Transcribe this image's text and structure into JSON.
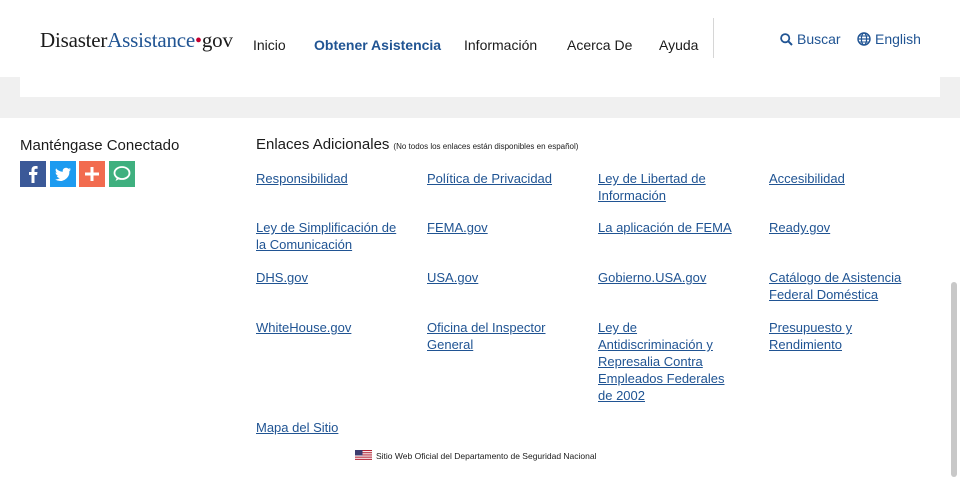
{
  "header": {
    "logo": {
      "part1": "Disaster",
      "part2": "Assistance",
      "dot": "•",
      "part3": "gov"
    },
    "nav": [
      {
        "label": "Inicio",
        "active": false
      },
      {
        "label": "Obtener Asistencia",
        "active": true
      },
      {
        "label": "Información",
        "active": false
      },
      {
        "label": "Acerca De",
        "active": false
      },
      {
        "label": "Ayuda",
        "active": false
      }
    ],
    "search_label": "Buscar",
    "language_label": "English"
  },
  "footer": {
    "connect_title": "Manténgase Conectado",
    "social": [
      {
        "icon": "facebook-icon",
        "color": "#3b5998"
      },
      {
        "icon": "twitter-icon",
        "color": "#1d9bf0"
      },
      {
        "icon": "plus-share-icon",
        "color": "#f26b4f"
      },
      {
        "icon": "chat-bubble-icon",
        "color": "#3fb07f"
      }
    ],
    "links_title": "Enlaces Adicionales",
    "links_note": "(No todos los enlaces están disponibles en español)",
    "links": [
      "Responsibilidad",
      "Política de Privacidad",
      "Ley de Libertad de Información",
      "Accesibilidad",
      "Ley de Simplificación de la Comunicación",
      "FEMA.gov",
      "La aplicación de FEMA",
      "Ready.gov",
      "DHS.gov",
      "USA.gov",
      "Gobierno.USA.gov",
      "Catálogo de Asistencia Federal Doméstica",
      "WhiteHouse.gov",
      "Oficina del Inspector General",
      "Ley de Antidiscriminación y Represalia Contra Empleados Federales de 2002",
      "Presupuesto y Rendimiento",
      "Mapa del Sitio"
    ],
    "official_text": "Sitio Web Oficial del Departamento de Seguridad Nacional"
  },
  "colors": {
    "link": "#205493",
    "brand_red": "#c3002f"
  }
}
